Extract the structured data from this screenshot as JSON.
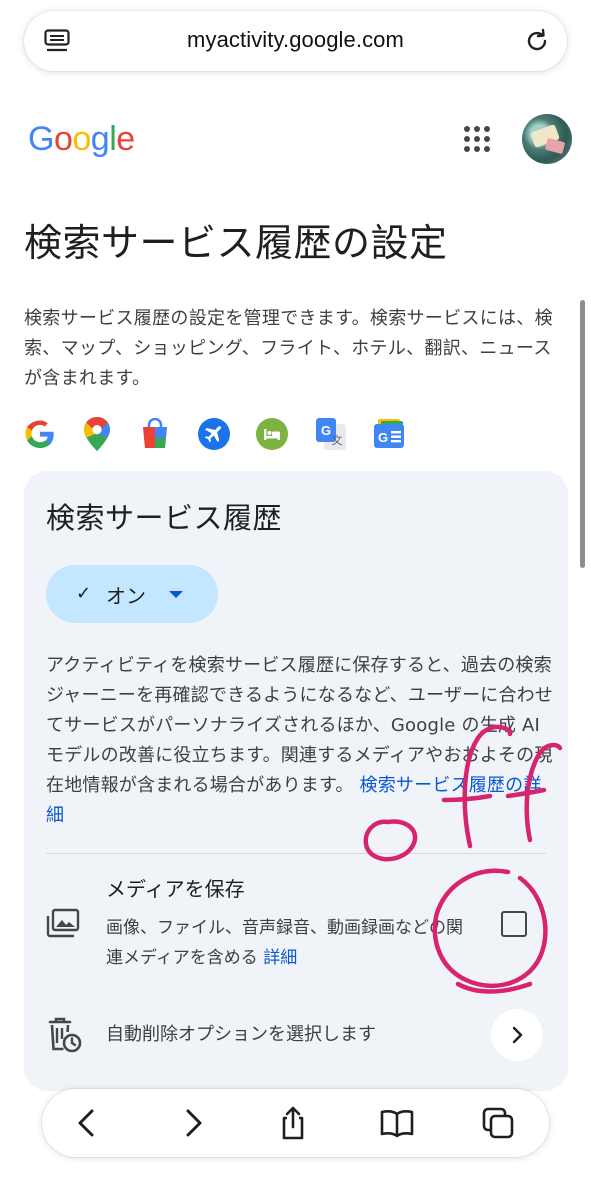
{
  "browser": {
    "url": "myactivity.google.com",
    "icons": {
      "reader": "reader-mode-icon",
      "reload": "reload-icon"
    }
  },
  "header": {
    "logo": [
      "G",
      "o",
      "o",
      "g",
      "l",
      "e"
    ],
    "logo_colors": [
      "#4285F4",
      "#EA4335",
      "#FBBC05",
      "#4285F4",
      "#34A853",
      "#EA4335"
    ],
    "apps_icon": "apps-grid-icon",
    "avatar_icon": "profile-avatar"
  },
  "page": {
    "title": "検索サービス履歴の設定",
    "description": "検索サービス履歴の設定を管理できます。検索サービスには、検索、マップ、ショッピング、フライト、ホテル、翻訳、ニュースが含まれます。",
    "service_icons": [
      "google-search-icon",
      "maps-icon",
      "shopping-icon",
      "flights-icon",
      "hotels-icon",
      "translate-icon",
      "news-icon"
    ]
  },
  "card": {
    "title": "検索サービス履歴",
    "status_chip": {
      "check": "✓",
      "label": "オン"
    },
    "description": "アクティビティを検索サービス履歴に保存すると、過去の検索ジャーニーを再確認できるようになるなど、ユーザーに合わせてサービスがパーソナライズされるほか、Google の生成 AI モデルの改善に役立ちます。関連するメディアやおおよその現在地情報が含まれる場合があります。",
    "description_link": "検索サービス履歴の詳細",
    "media": {
      "title": "メディアを保存",
      "description": "画像、ファイル、音声録音、動画録画などの関連メディアを含める",
      "link": "詳細",
      "checked": false
    },
    "auto_delete": {
      "label": "自動削除オプションを選択します"
    }
  },
  "annotation": {
    "text": "off",
    "color": "#d6246e"
  },
  "toolbar": {
    "items": [
      "back-icon",
      "forward-icon",
      "share-icon",
      "bookmarks-icon",
      "tabs-icon"
    ]
  }
}
